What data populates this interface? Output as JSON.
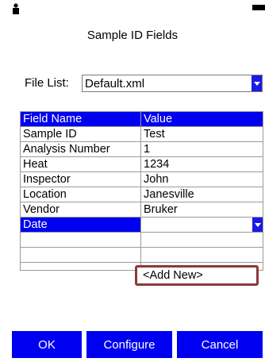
{
  "window": {
    "title": "Sample ID Fields"
  },
  "file_list": {
    "label": "File List:",
    "value": "Default.xml"
  },
  "table": {
    "headers": [
      "Field Name",
      "Value"
    ],
    "rows": [
      {
        "name": "Sample ID",
        "value": "Test"
      },
      {
        "name": "Analysis Number",
        "value": "1"
      },
      {
        "name": "Heat",
        "value": "1234"
      },
      {
        "name": "Inspector",
        "value": "John"
      },
      {
        "name": "Location",
        "value": "Janesville"
      },
      {
        "name": "Vendor",
        "value": "Bruker"
      },
      {
        "name": "Date",
        "value": ""
      }
    ]
  },
  "dropdown_option": "<Add New>",
  "buttons": {
    "ok": "OK",
    "configure": "Configure",
    "cancel": "Cancel"
  },
  "colors": {
    "accent": "#0000f0",
    "highlight_border": "#8a3a3a"
  },
  "icons": {
    "status_left": "user-icon",
    "status_right": "battery-icon"
  }
}
